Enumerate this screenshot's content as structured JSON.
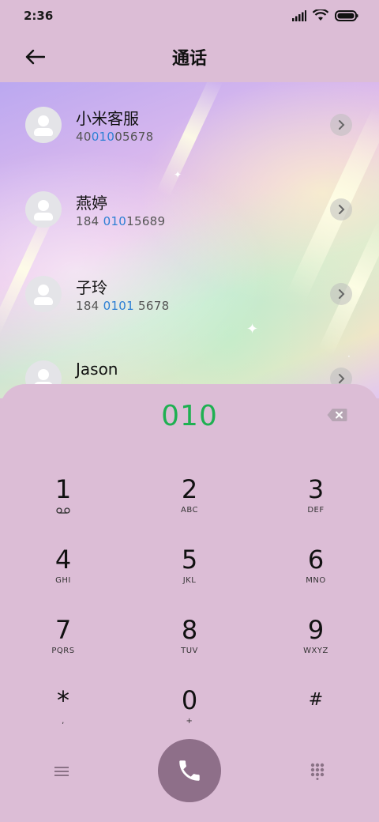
{
  "status_bar": {
    "time": "2:36"
  },
  "header": {
    "title": "通话"
  },
  "contacts": [
    {
      "name": "小米客服",
      "number_pre": "40",
      "number_hl": "010",
      "number_post": "05678"
    },
    {
      "name": "燕婷",
      "number_pre": "184 ",
      "number_hl": "010",
      "number_post": "15689"
    },
    {
      "name": "子玲",
      "number_pre": "184 ",
      "number_hl": "0101",
      "number_post": " 5678"
    },
    {
      "name": "Jason",
      "number_pre": "",
      "number_hl": "",
      "number_post": ""
    }
  ],
  "dialpad": {
    "dialed": "010",
    "keys": [
      {
        "digit": "1",
        "letters": ""
      },
      {
        "digit": "2",
        "letters": "ABC"
      },
      {
        "digit": "3",
        "letters": "DEF"
      },
      {
        "digit": "4",
        "letters": "GHI"
      },
      {
        "digit": "5",
        "letters": "JKL"
      },
      {
        "digit": "6",
        "letters": "MNO"
      },
      {
        "digit": "7",
        "letters": "PQRS"
      },
      {
        "digit": "8",
        "letters": "TUV"
      },
      {
        "digit": "9",
        "letters": "WXYZ"
      },
      {
        "digit": "*",
        "letters": ","
      },
      {
        "digit": "0",
        "letters": "+"
      },
      {
        "digit": "#",
        "letters": ""
      }
    ]
  },
  "colors": {
    "background": "#dcbdd6",
    "dialed_text": "#1fb052",
    "highlight": "#2d7fd4",
    "call_button": "#8e6f89"
  }
}
